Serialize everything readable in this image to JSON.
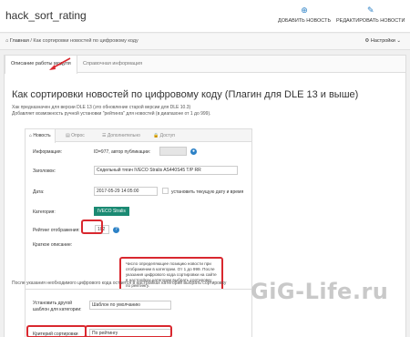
{
  "app": {
    "title": "hack_sort_rating"
  },
  "toolbar": {
    "add_news": "ДОБАВИТЬ НОВОСТЬ",
    "edit_news": "РЕДАКТИРОВАТЬ НОВОСТИ"
  },
  "breadcrumb": {
    "home": "Главная",
    "separator": "/",
    "current": "Как сортировки новостей по цифровому коду"
  },
  "settings": {
    "label": "Настройки"
  },
  "tabs": [
    {
      "label": "Описание работы модуля"
    },
    {
      "label": "Справочная информация"
    }
  ],
  "main": {
    "heading": "Как сортировки новостей по цифровому коду (Плагин для DLE 13 и выше)",
    "desc1": "Хак предназначен для версии DLE 13 (это обновление старой версии для DLE 10.3)",
    "desc2": "Добавляет возможность ручной установки \"рейтинга\" для новостей (в диапазоне от 1 до 999)."
  },
  "inner": {
    "tabs": [
      "Новость",
      "Опрос",
      "Дополнительно",
      "Доступ"
    ],
    "info_label": "Информация:",
    "info_value": "ID=977, автор публикации:",
    "title_label": "Заголовок:",
    "title_value": "Седельный тягач IVECO Stralis AS440S45 T/P RR",
    "date_label": "Дата:",
    "date_value": "2017-05-29 14:05:00",
    "date_check": "установить текущую дату и время",
    "category_label": "Категория:",
    "category_value": "IVECO Stralis",
    "rating_label": "Рейтинг отображения:",
    "rating_value": "102",
    "short_label": "Краткое описание:",
    "tooltip": "Число определяющее позицию новости при отображении в категории. От 1 до 999. После указания цифрового кода сортировки на сайте в настройках категории выбрать сортировку по рейтингу."
  },
  "bottom": {
    "note": "После указания необходимого цифрового кода остается в настройках категории выбрать сортировку",
    "template_label": "Установить другой шаблон для категории:",
    "template_value": "Шаблон по умолчанию",
    "sort_label": "Критерий сортировки",
    "sort_value": "По рейтингу"
  },
  "watermark": "GiG-Life.ru",
  "colors": {
    "accent": "#2c81c6",
    "highlight": "#d9282f",
    "green": "#1b8a73"
  }
}
